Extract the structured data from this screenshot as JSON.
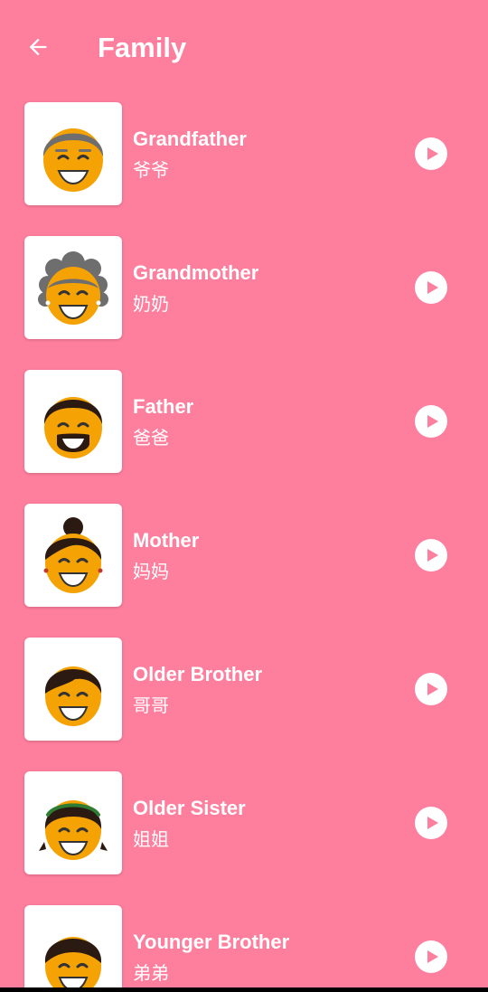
{
  "header": {
    "back_icon": "arrow-left-icon",
    "title": "Family"
  },
  "colors": {
    "background": "#FD7E9D",
    "card": "#FFFFFF",
    "face": "#F5A205",
    "play_triangle": "#FD7E9D"
  },
  "items": [
    {
      "english": "Grandfather",
      "chinese": "爷爷",
      "avatar_icon": "grandfather-avatar-icon",
      "play_icon": "play-icon"
    },
    {
      "english": "Grandmother",
      "chinese": "奶奶",
      "avatar_icon": "grandmother-avatar-icon",
      "play_icon": "play-icon"
    },
    {
      "english": "Father",
      "chinese": "爸爸",
      "avatar_icon": "father-avatar-icon",
      "play_icon": "play-icon"
    },
    {
      "english": "Mother",
      "chinese": "妈妈",
      "avatar_icon": "mother-avatar-icon",
      "play_icon": "play-icon"
    },
    {
      "english": "Older Brother",
      "chinese": "哥哥",
      "avatar_icon": "older-brother-avatar-icon",
      "play_icon": "play-icon"
    },
    {
      "english": "Older Sister",
      "chinese": "姐姐",
      "avatar_icon": "older-sister-avatar-icon",
      "play_icon": "play-icon"
    },
    {
      "english": "Younger Brother",
      "chinese": "弟弟",
      "avatar_icon": "younger-brother-avatar-icon",
      "play_icon": "play-icon"
    }
  ]
}
